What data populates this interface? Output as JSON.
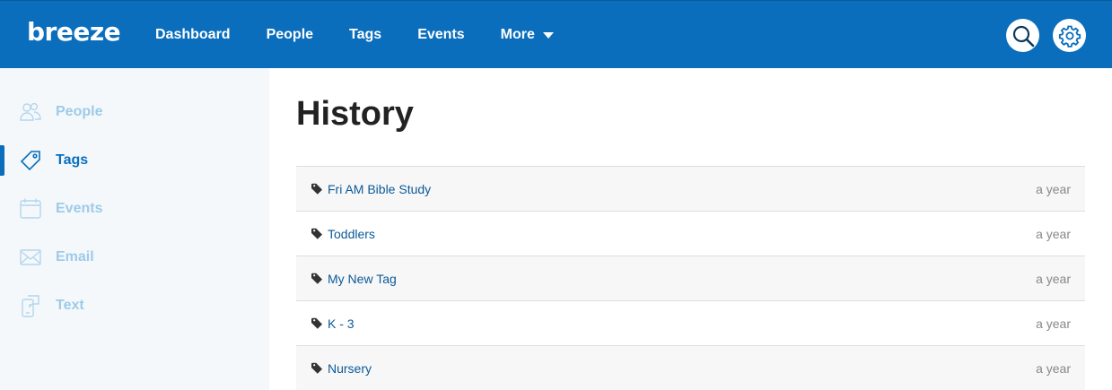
{
  "header": {
    "logo": "breeze",
    "nav": [
      {
        "label": "Dashboard"
      },
      {
        "label": "People"
      },
      {
        "label": "Tags"
      },
      {
        "label": "Events"
      },
      {
        "label": "More"
      }
    ],
    "icons": [
      "search-icon",
      "gear-icon"
    ]
  },
  "sidebar": {
    "items": [
      {
        "label": "People",
        "icon": "people-icon",
        "active": false
      },
      {
        "label": "Tags",
        "icon": "tag-icon",
        "active": true
      },
      {
        "label": "Events",
        "icon": "calendar-icon",
        "active": false
      },
      {
        "label": "Email",
        "icon": "envelope-icon",
        "active": false
      },
      {
        "label": "Text",
        "icon": "phone-chat-icon",
        "active": false
      }
    ]
  },
  "main": {
    "title": "History",
    "rows": [
      {
        "name": "Fri AM Bible Study",
        "time": "a year"
      },
      {
        "name": "Toddlers",
        "time": "a year"
      },
      {
        "name": "My New Tag",
        "time": "a year"
      },
      {
        "name": "K - 3",
        "time": "a year"
      },
      {
        "name": "Nursery",
        "time": "a year"
      }
    ]
  },
  "colors": {
    "brand_blue": "#0a6ebd",
    "sidebar_bg": "#f4f8fb",
    "sidebar_inactive": "#9ecbe8",
    "link": "#0b5a98"
  }
}
